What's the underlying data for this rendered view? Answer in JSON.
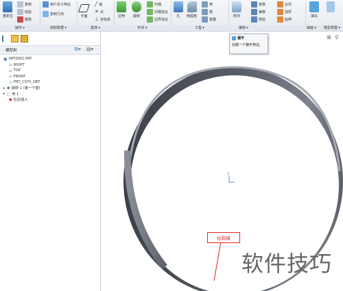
{
  "ribbon": {
    "tools": {
      "regenerate": "重新生",
      "copy": "复制",
      "paste": "粘贴",
      "delete": "删除",
      "user_feature": "用户定义特征",
      "copy_geom": "复制几何",
      "plane": "平面",
      "axis": "轴",
      "point": "点",
      "coord_sys": "坐标系",
      "extrude": "拉伸",
      "revolve": "旋转",
      "sweep": "扫描",
      "blend": "扫描混合",
      "swept_blend": "边界混合",
      "hole": "孔",
      "round": "倒圆角",
      "shell": "壳",
      "rib": "筋",
      "draft": "拔模",
      "pattern": "阵列",
      "mirror": "镜像",
      "offset": "偏移",
      "trim": "修剪",
      "merge": "合并",
      "thicken": "加厚",
      "fill": "填充",
      "extend": "延伸"
    },
    "groups": [
      "操作",
      "获取数据",
      "基准",
      "形状",
      "工程",
      "编辑",
      "曲面",
      "模型意图"
    ]
  },
  "left_panel": {
    "tab_label": "模型树",
    "items": [
      {
        "label": "PRT0001.PRT",
        "icon": "part-icon"
      },
      {
        "label": "RIGHT",
        "icon": "plane-icon"
      },
      {
        "label": "TOP",
        "icon": "plane-icon"
      },
      {
        "label": "FRONT",
        "icon": "plane-icon"
      },
      {
        "label": "PRT_CSYS_DEF",
        "icon": "csys-icon"
      },
      {
        "label": "旋转 1 (第一个壁)",
        "icon": "revolve-icon"
      },
      {
        "label": "壳 1",
        "icon": "shell-icon"
      },
      {
        "label": "在此插入",
        "icon": "insert-icon"
      }
    ]
  },
  "tooltip": {
    "title": "偏平",
    "text": "创建一个偏平特征。"
  },
  "canvas": {
    "callout_label": "拉裂缝",
    "datum_label": "X"
  },
  "watermark": "软件技巧",
  "colors": {
    "ring_dark": "#3c4048",
    "ring_light": "#a5aab3",
    "accent": "#2f6fb2",
    "callout": "#dd2222"
  }
}
